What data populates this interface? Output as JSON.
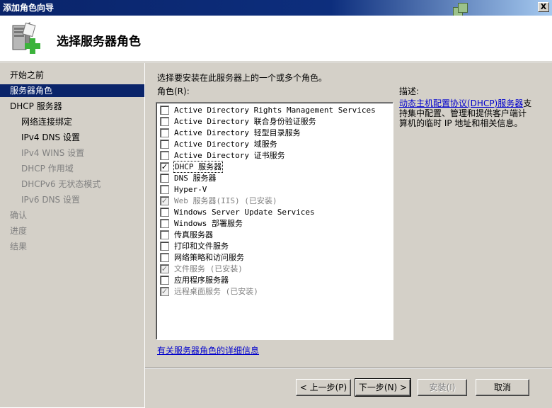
{
  "window": {
    "title": "添加角色向导",
    "close_label": "X"
  },
  "header": {
    "title": "选择服务器角色"
  },
  "sidebar": {
    "items": [
      {
        "label": "开始之前",
        "level": "top",
        "state": "normal"
      },
      {
        "label": "服务器角色",
        "level": "top",
        "state": "selected"
      },
      {
        "label": "DHCP 服务器",
        "level": "top",
        "state": "normal"
      },
      {
        "label": "网络连接绑定",
        "level": "sub",
        "state": "normal"
      },
      {
        "label": "IPv4 DNS 设置",
        "level": "sub",
        "state": "normal"
      },
      {
        "label": "IPv4 WINS 设置",
        "level": "sub",
        "state": "dim"
      },
      {
        "label": "DHCP 作用域",
        "level": "sub",
        "state": "dim"
      },
      {
        "label": "DHCPv6 无状态模式",
        "level": "sub",
        "state": "dim"
      },
      {
        "label": "IPv6 DNS 设置",
        "level": "sub",
        "state": "dim"
      },
      {
        "label": "确认",
        "level": "top",
        "state": "dim"
      },
      {
        "label": "进度",
        "level": "top",
        "state": "dim"
      },
      {
        "label": "结果",
        "level": "top",
        "state": "dim"
      }
    ]
  },
  "main": {
    "instruction": "选择要安装在此服务器上的一个或多个角色。",
    "roles_label": "角色(R):",
    "roles": [
      {
        "label": "Active Directory Rights Management Services",
        "checked": false,
        "disabled": false,
        "focused": false
      },
      {
        "label": "Active Directory 联合身份验证服务",
        "checked": false,
        "disabled": false,
        "focused": false
      },
      {
        "label": "Active Directory 轻型目录服务",
        "checked": false,
        "disabled": false,
        "focused": false
      },
      {
        "label": "Active Directory 域服务",
        "checked": false,
        "disabled": false,
        "focused": false
      },
      {
        "label": "Active Directory 证书服务",
        "checked": false,
        "disabled": false,
        "focused": false
      },
      {
        "label": "DHCP 服务器",
        "checked": true,
        "disabled": false,
        "focused": true
      },
      {
        "label": "DNS 服务器",
        "checked": false,
        "disabled": false,
        "focused": false
      },
      {
        "label": "Hyper-V",
        "checked": false,
        "disabled": false,
        "focused": false
      },
      {
        "label": "Web 服务器(IIS)  (已安装)",
        "checked": true,
        "disabled": true,
        "focused": false
      },
      {
        "label": "Windows Server Update Services",
        "checked": false,
        "disabled": false,
        "focused": false
      },
      {
        "label": "Windows 部署服务",
        "checked": false,
        "disabled": false,
        "focused": false
      },
      {
        "label": "传真服务器",
        "checked": false,
        "disabled": false,
        "focused": false
      },
      {
        "label": "打印和文件服务",
        "checked": false,
        "disabled": false,
        "focused": false
      },
      {
        "label": "网络策略和访问服务",
        "checked": false,
        "disabled": false,
        "focused": false
      },
      {
        "label": "文件服务  (已安装)",
        "checked": true,
        "disabled": true,
        "focused": false
      },
      {
        "label": "应用程序服务器",
        "checked": false,
        "disabled": false,
        "focused": false
      },
      {
        "label": "远程桌面服务  (已安装)",
        "checked": true,
        "disabled": true,
        "focused": false
      }
    ],
    "description_label": "描述:",
    "description_link": "动态主机配置协议(DHCP)服务器",
    "description_text": "支持集中配置、管理和提供客户端计算机的临时 IP 地址和相关信息。",
    "more_info_link": "有关服务器角色的详细信息"
  },
  "buttons": {
    "prev": "< 上一步(P)",
    "next": "下一步(N) >",
    "install": "安装(I)",
    "cancel": "取消"
  }
}
